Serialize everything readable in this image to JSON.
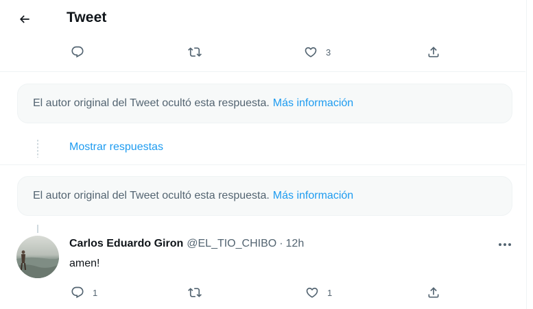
{
  "header": {
    "title": "Tweet",
    "back_icon": "arrow-left-icon"
  },
  "main_tweet_actions": {
    "reply_count": "",
    "retweet_count": "",
    "like_count": "3",
    "share_count": ""
  },
  "hidden_reply_1": {
    "text": "El autor original del Tweet ocultó esta respuesta.",
    "link": "Más información"
  },
  "show_replies": {
    "label": "Mostrar respuestas"
  },
  "hidden_reply_2": {
    "text": "El autor original del Tweet ocultó esta respuesta.",
    "link": "Más información"
  },
  "reply": {
    "display_name": "Carlos Eduardo Giron",
    "handle": "@EL_TIO_CHIBO",
    "separator": "·",
    "time": "12h",
    "text": "amen!",
    "actions": {
      "reply_count": "1",
      "retweet_count": "",
      "like_count": "1",
      "share_count": ""
    }
  },
  "colors": {
    "accent": "#1d9bf0",
    "muted": "#536471",
    "text": "#0f1419",
    "notice_bg": "#f7f9f9"
  }
}
